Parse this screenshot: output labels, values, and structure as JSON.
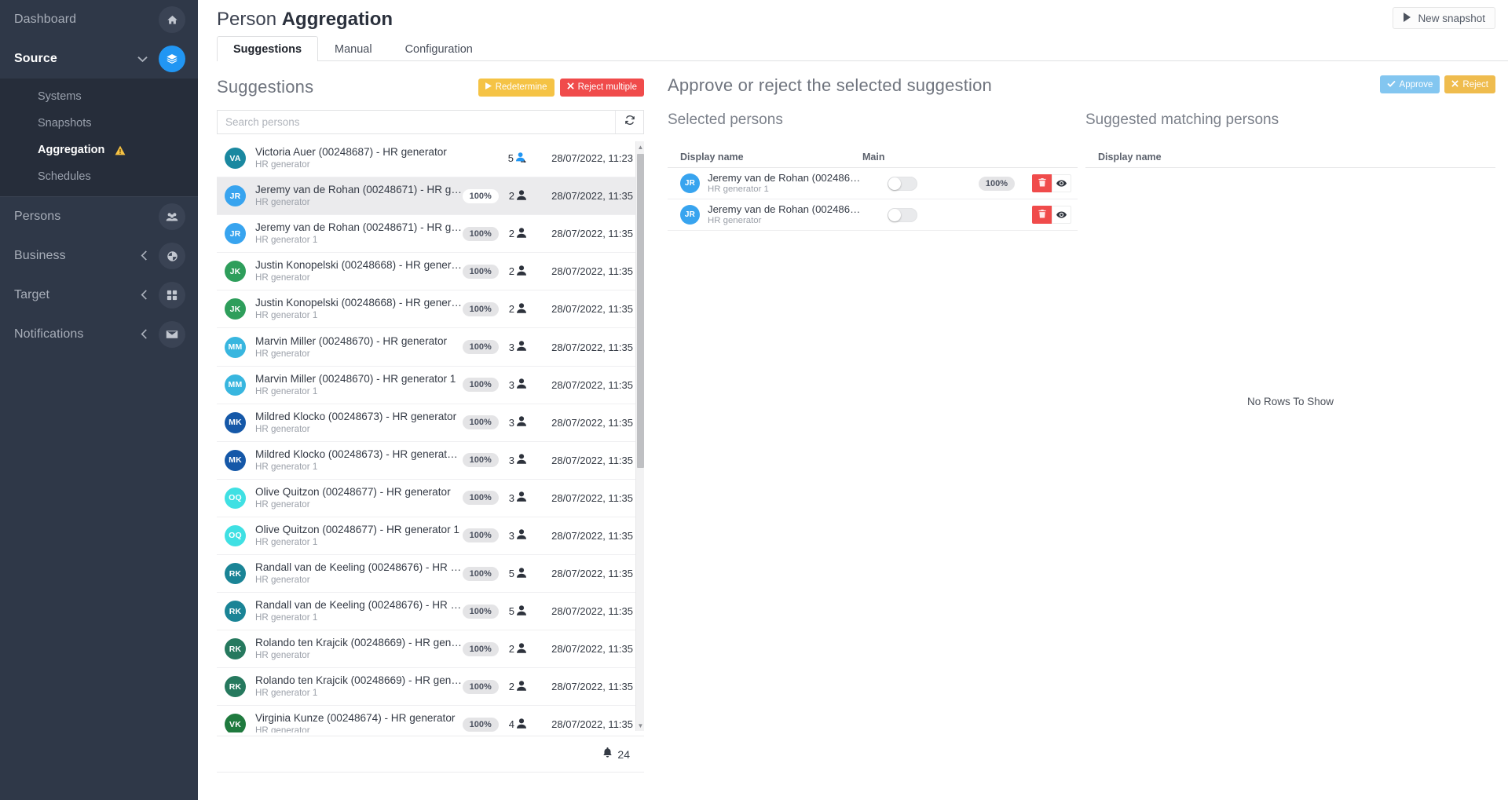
{
  "sidebar": {
    "top_items": [
      {
        "label": "Dashboard",
        "icon": "home-icon",
        "has_chevron": false,
        "active": false
      },
      {
        "label": "Source",
        "icon": "layers-icon",
        "has_chevron": true,
        "active": true
      }
    ],
    "submenu": [
      {
        "label": "Systems",
        "active": false,
        "warning": false
      },
      {
        "label": "Snapshots",
        "active": false,
        "warning": false
      },
      {
        "label": "Aggregation",
        "active": true,
        "warning": true
      },
      {
        "label": "Schedules",
        "active": false,
        "warning": false
      }
    ],
    "bottom_items": [
      {
        "label": "Persons",
        "icon": "people-icon",
        "has_chevron": false
      },
      {
        "label": "Business",
        "icon": "pie-icon",
        "has_chevron": true
      },
      {
        "label": "Target",
        "icon": "grid-icon",
        "has_chevron": true
      },
      {
        "label": "Notifications",
        "icon": "mail-icon",
        "has_chevron": true
      }
    ]
  },
  "header": {
    "title_light": "Person",
    "title_bold": "Aggregation",
    "new_snapshot_label": "New snapshot",
    "new_snapshot_icon": "play-icon"
  },
  "tabs": [
    {
      "label": "Suggestions",
      "active": true
    },
    {
      "label": "Manual",
      "active": false
    },
    {
      "label": "Configuration",
      "active": false
    }
  ],
  "left_panel": {
    "title": "Suggestions",
    "redetermine_label": "Redetermine",
    "redetermine_icon": "play-icon",
    "reject_multiple_label": "Reject multiple",
    "reject_multiple_icon": "close-icon",
    "search_placeholder": "Search persons",
    "search_value": "",
    "refresh_icon": "refresh-icon",
    "footer_count": "24",
    "footer_icon": "bell-icon",
    "suggestions": [
      {
        "initials": "VA",
        "color": "#1a88a0",
        "name": "Victoria Auer (00248687) - HR generator",
        "sub": "HR generator",
        "percent": "",
        "count": "5",
        "count_icon": "person-export-icon",
        "date": "28/07/2022, 11:23",
        "selected": false
      },
      {
        "initials": "JR",
        "color": "#38a4ef",
        "name": "Jeremy van de Rohan (00248671) - HR gene…",
        "sub": "HR generator",
        "percent": "100%",
        "count": "2",
        "count_icon": "person-icon",
        "date": "28/07/2022, 11:35",
        "selected": true
      },
      {
        "initials": "JR",
        "color": "#38a4ef",
        "name": "Jeremy van de Rohan (00248671) - HR gene…",
        "sub": "HR generator 1",
        "percent": "100%",
        "count": "2",
        "count_icon": "person-icon",
        "date": "28/07/2022, 11:35",
        "selected": false
      },
      {
        "initials": "JK",
        "color": "#2e9e5b",
        "name": "Justin Konopelski (00248668) - HR generator",
        "sub": "HR generator",
        "percent": "100%",
        "count": "2",
        "count_icon": "person-icon",
        "date": "28/07/2022, 11:35",
        "selected": false
      },
      {
        "initials": "JK",
        "color": "#2e9e5b",
        "name": "Justin Konopelski (00248668) - HR generato…",
        "sub": "HR generator 1",
        "percent": "100%",
        "count": "2",
        "count_icon": "person-icon",
        "date": "28/07/2022, 11:35",
        "selected": false
      },
      {
        "initials": "MM",
        "color": "#38b6df",
        "name": "Marvin Miller (00248670) - HR generator",
        "sub": "HR generator",
        "percent": "100%",
        "count": "3",
        "count_icon": "person-icon",
        "date": "28/07/2022, 11:35",
        "selected": false
      },
      {
        "initials": "MM",
        "color": "#38b6df",
        "name": "Marvin Miller (00248670) - HR generator 1",
        "sub": "HR generator 1",
        "percent": "100%",
        "count": "3",
        "count_icon": "person-icon",
        "date": "28/07/2022, 11:35",
        "selected": false
      },
      {
        "initials": "MK",
        "color": "#1558a8",
        "name": "Mildred Klocko (00248673) - HR generator",
        "sub": "HR generator",
        "percent": "100%",
        "count": "3",
        "count_icon": "person-icon",
        "date": "28/07/2022, 11:35",
        "selected": false
      },
      {
        "initials": "MK",
        "color": "#1558a8",
        "name": "Mildred Klocko (00248673) - HR generator 1",
        "sub": "HR generator 1",
        "percent": "100%",
        "count": "3",
        "count_icon": "person-icon",
        "date": "28/07/2022, 11:35",
        "selected": false
      },
      {
        "initials": "OQ",
        "color": "#3fe0e3",
        "name": "Olive Quitzon (00248677) - HR generator",
        "sub": "HR generator",
        "percent": "100%",
        "count": "3",
        "count_icon": "person-icon",
        "date": "28/07/2022, 11:35",
        "selected": false
      },
      {
        "initials": "OQ",
        "color": "#3fe0e3",
        "name": "Olive Quitzon (00248677) - HR generator 1",
        "sub": "HR generator 1",
        "percent": "100%",
        "count": "3",
        "count_icon": "person-icon",
        "date": "28/07/2022, 11:35",
        "selected": false
      },
      {
        "initials": "RK",
        "color": "#1a8496",
        "name": "Randall van de Keeling (00248676) - HR gen…",
        "sub": "HR generator",
        "percent": "100%",
        "count": "5",
        "count_icon": "person-icon",
        "date": "28/07/2022, 11:35",
        "selected": false
      },
      {
        "initials": "RK",
        "color": "#1a8496",
        "name": "Randall van de Keeling (00248676) - HR gen…",
        "sub": "HR generator 1",
        "percent": "100%",
        "count": "5",
        "count_icon": "person-icon",
        "date": "28/07/2022, 11:35",
        "selected": false
      },
      {
        "initials": "RK",
        "color": "#26795e",
        "name": "Rolando ten Krajcik (00248669) - HR generat…",
        "sub": "HR generator",
        "percent": "100%",
        "count": "2",
        "count_icon": "person-icon",
        "date": "28/07/2022, 11:35",
        "selected": false
      },
      {
        "initials": "RK",
        "color": "#26795e",
        "name": "Rolando ten Krajcik (00248669) - HR generat…",
        "sub": "HR generator 1",
        "percent": "100%",
        "count": "2",
        "count_icon": "person-icon",
        "date": "28/07/2022, 11:35",
        "selected": false
      },
      {
        "initials": "VK",
        "color": "#1f7a3e",
        "name": "Virginia Kunze (00248674) - HR generator",
        "sub": "HR generator",
        "percent": "100%",
        "count": "4",
        "count_icon": "person-icon",
        "date": "28/07/2022, 11:35",
        "selected": false
      }
    ]
  },
  "right_panel": {
    "title": "Approve or reject the selected suggestion",
    "approve_label": "Approve",
    "approve_icon": "check-icon",
    "reject_label": "Reject",
    "reject_icon": "close-icon",
    "selected_persons": {
      "label": "Selected persons",
      "columns": {
        "display_name": "Display name",
        "main": "Main"
      },
      "rows": [
        {
          "initials": "JR",
          "color": "#38a4ef",
          "name": "Jeremy van de Rohan (00248671) -…",
          "sub": "HR generator 1",
          "main_on": false,
          "percent": "100%",
          "delete_icon": "trash-icon",
          "view_icon": "eye-icon"
        },
        {
          "initials": "JR",
          "color": "#38a4ef",
          "name": "Jeremy van de Rohan (00248671) -…",
          "sub": "HR generator",
          "main_on": false,
          "percent": "",
          "delete_icon": "trash-icon",
          "view_icon": "eye-icon"
        }
      ]
    },
    "suggested_persons": {
      "label": "Suggested matching persons",
      "columns": {
        "display_name": "Display name"
      },
      "empty_message": "No Rows To Show",
      "rows": []
    }
  }
}
